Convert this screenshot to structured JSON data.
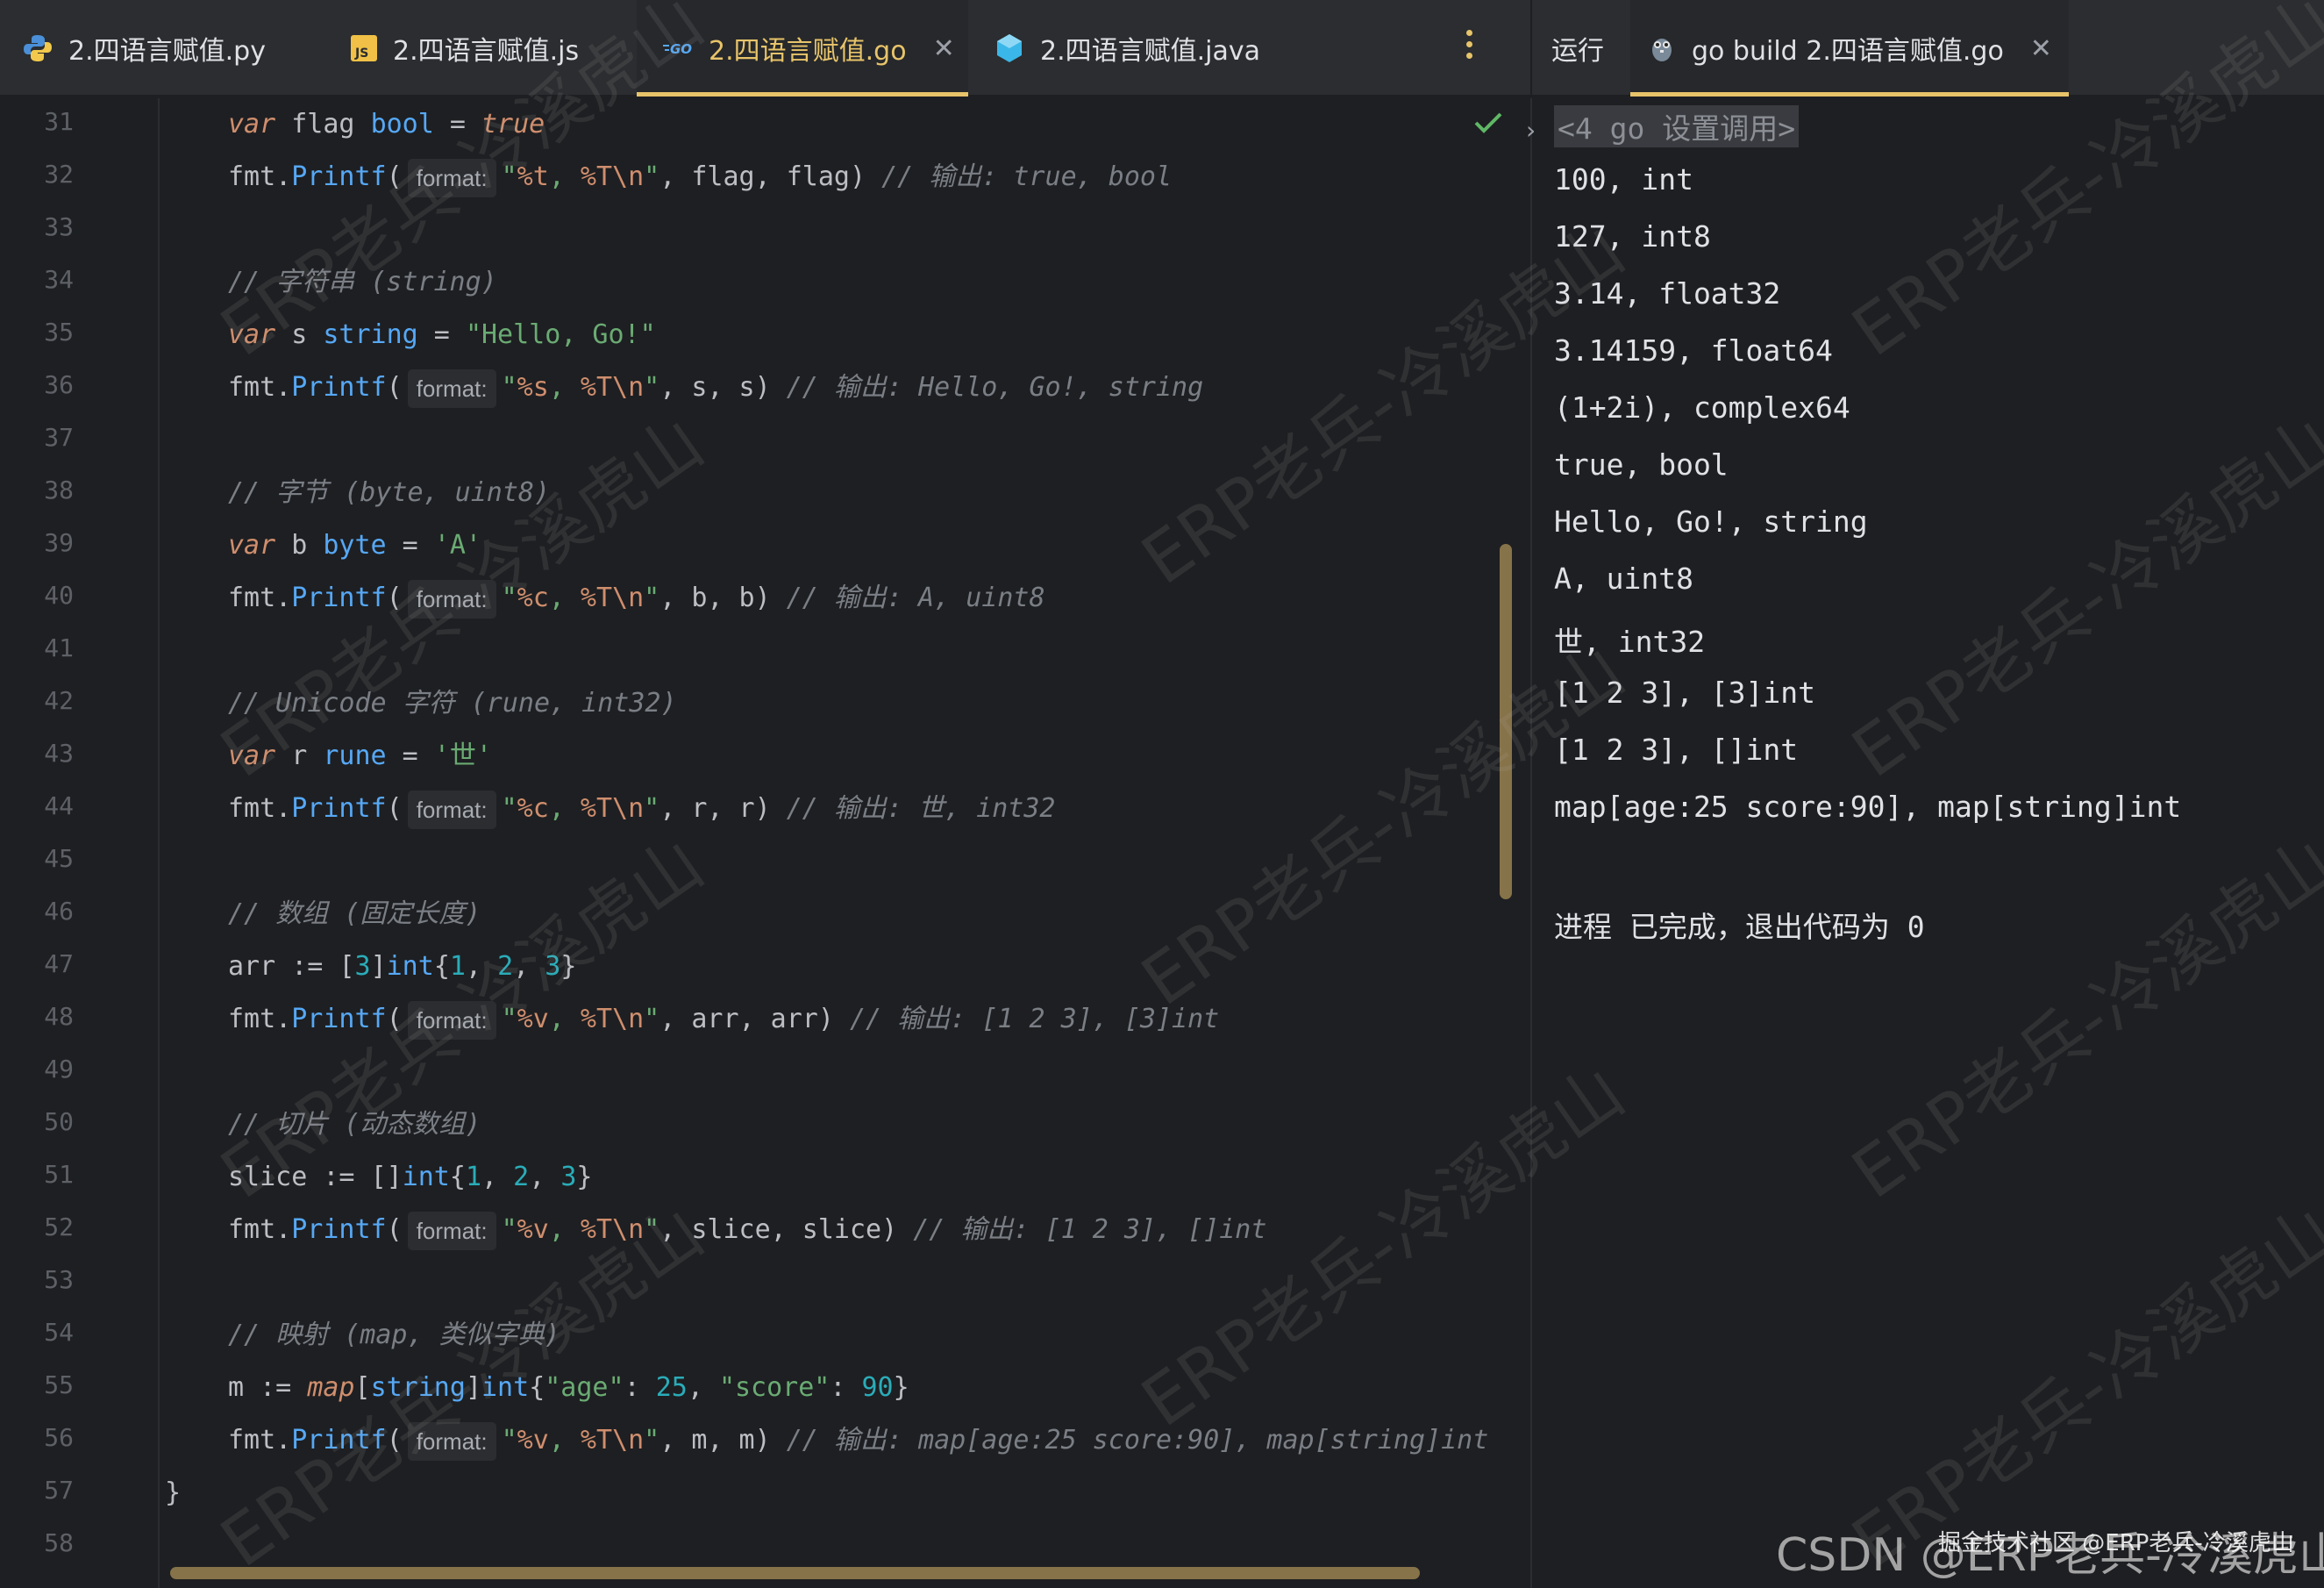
{
  "tabs": [
    {
      "label": "2.四语言赋值.py",
      "icon": "python-icon"
    },
    {
      "label": "2.四语言赋值.js",
      "icon": "js-icon"
    },
    {
      "label": "2.四语言赋值.go",
      "icon": "go-icon",
      "active": true
    },
    {
      "label": "2.四语言赋值.java",
      "icon": "java-icon"
    }
  ],
  "run_panel": {
    "title": "运行",
    "tab_label": "go build 2.四语言赋值.go",
    "command": "<4 go 设置调用>",
    "output": [
      "100, int",
      "127, int8",
      "3.14, float32",
      "3.14159, float64",
      "(1+2i), complex64",
      "true, bool",
      "Hello, Go!, string",
      "A, uint8",
      "世, int32",
      "[1 2 3], [3]int",
      "[1 2 3], []int",
      "map[age:25 score:90], map[string]int"
    ],
    "exit_message": "进程 已完成，退出代码为 0"
  },
  "editor": {
    "line_numbers": [
      "31",
      "32",
      "33",
      "34",
      "35",
      "36",
      "37",
      "38",
      "39",
      "40",
      "41",
      "42",
      "43",
      "44",
      "45",
      "46",
      "47",
      "48",
      "49",
      "50",
      "51",
      "52",
      "53",
      "54",
      "55",
      "56",
      "57",
      "58"
    ],
    "param_hint": "format:",
    "closing_brace": "}",
    "lines": {
      "l31": {
        "kw": "var",
        "name": " flag ",
        "type": "bool",
        "op": " = ",
        "val": "true"
      },
      "l32": {
        "pkg": "fmt.",
        "fn": "Printf",
        "p1": "(",
        "s_open": "\"",
        "f1": "%t",
        "s_mid": ", ",
        "f2": "%T",
        "esc": "\\n",
        "s_close": "\"",
        "args": ", flag, flag",
        "p2": ")",
        "comment": " // 输出: true, bool"
      },
      "l34": {
        "comment": "// 字符串 (string)"
      },
      "l35": {
        "kw": "var",
        "name": " s ",
        "type": "string",
        "op": " = ",
        "val": "\"Hello, Go!\""
      },
      "l36": {
        "pkg": "fmt.",
        "fn": "Printf",
        "p1": "(",
        "s_open": "\"",
        "f1": "%s",
        "s_mid": ", ",
        "f2": "%T",
        "esc": "\\n",
        "s_close": "\"",
        "args": ", s, s",
        "p2": ")",
        "comment": " // 输出: Hello, Go!, string"
      },
      "l38": {
        "comment": "// 字节 (byte, uint8)"
      },
      "l39": {
        "kw": "var",
        "name": " b ",
        "type": "byte",
        "op": " = ",
        "val": "'A'"
      },
      "l40": {
        "pkg": "fmt.",
        "fn": "Printf",
        "p1": "(",
        "s_open": "\"",
        "f1": "%c",
        "s_mid": ", ",
        "f2": "%T",
        "esc": "\\n",
        "s_close": "\"",
        "args": ", b, b",
        "p2": ")",
        "comment": " // 输出: A, uint8"
      },
      "l42": {
        "comment": "// Unicode 字符 (rune, int32)"
      },
      "l43": {
        "kw": "var",
        "name": " r ",
        "type": "rune",
        "op": " = ",
        "val": "'世'"
      },
      "l44": {
        "pkg": "fmt.",
        "fn": "Printf",
        "p1": "(",
        "s_open": "\"",
        "f1": "%c",
        "s_mid": ", ",
        "f2": "%T",
        "esc": "\\n",
        "s_close": "\"",
        "args": ", r, r",
        "p2": ")",
        "comment": " // 输出: 世, int32"
      },
      "l46": {
        "comment": "// 数组 (固定长度)"
      },
      "l47": {
        "name": "arr",
        "op": " := ",
        "pre": "[",
        "n0": "3",
        "mid": "]",
        "type": "int",
        "ob": "{",
        "n1": "1",
        "c1": ", ",
        "n2": "2",
        "c2": ", ",
        "n3": "3",
        "cb": "}"
      },
      "l48": {
        "pkg": "fmt.",
        "fn": "Printf",
        "p1": "(",
        "s_open": "\"",
        "f1": "%v",
        "s_mid": ", ",
        "f2": "%T",
        "esc": "\\n",
        "s_close": "\"",
        "args": ", arr, arr",
        "p2": ")",
        "comment": " // 输出: [1 2 3], [3]int"
      },
      "l50": {
        "comment": "// 切片 (动态数组)"
      },
      "l51": {
        "name": "slice",
        "op": " := ",
        "pre": "[]",
        "type": "int",
        "ob": "{",
        "n1": "1",
        "c1": ", ",
        "n2": "2",
        "c2": ", ",
        "n3": "3",
        "cb": "}"
      },
      "l52": {
        "pkg": "fmt.",
        "fn": "Printf",
        "p1": "(",
        "s_open": "\"",
        "f1": "%v",
        "s_mid": ", ",
        "f2": "%T",
        "esc": "\\n",
        "s_close": "\"",
        "args": ", slice, slice",
        "p2": ")",
        "comment": " // 输出: [1 2 3], []int"
      },
      "l54": {
        "comment": "// 映射 (map, 类似字典)"
      },
      "l55": {
        "name": "m",
        "op": " := ",
        "kw": "map",
        "b1": "[",
        "t1": "string",
        "b2": "]",
        "t2": "int",
        "ob": "{",
        "k1": "\"age\"",
        "col1": ": ",
        "v1": "25",
        "cm": ", ",
        "k2": "\"score\"",
        "col2": ": ",
        "v2": "90",
        "cb": "}"
      },
      "l56": {
        "pkg": "fmt.",
        "fn": "Printf",
        "p1": "(",
        "s_open": "\"",
        "f1": "%v",
        "s_mid": ", ",
        "f2": "%T",
        "esc": "\\n",
        "s_close": "\"",
        "args": ", m, m",
        "p2": ")",
        "comment": " // 输出: map[age:25 score:90], map[string]int"
      }
    }
  },
  "watermarks": {
    "text": "ERP老兵-冷溪虎山",
    "footer": "CSDN @ERP老兵-冷溪虎山",
    "footer_sub": "掘金技术社区 @ERP老兵-冷溪虎山"
  },
  "colors": {
    "accent": "#e8c46a",
    "keyword": "#cf8e6d",
    "type": "#56a8f5",
    "string": "#6aab73",
    "number": "#2aacb8",
    "comment": "#7a7e85",
    "background": "#1e1f22"
  }
}
